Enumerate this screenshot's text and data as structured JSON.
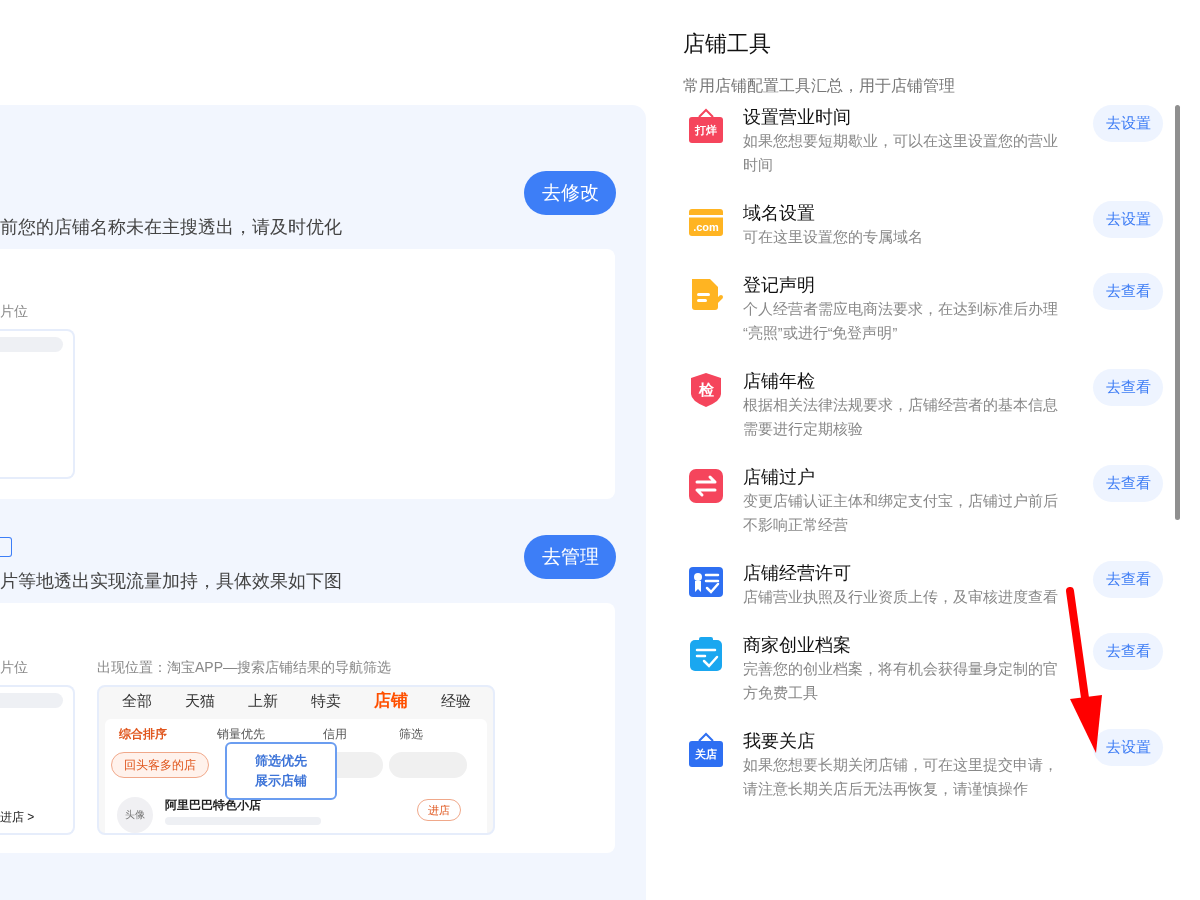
{
  "name_section": {
    "description": "前您的店铺名称未在主搜透出，请及时优化",
    "button": "去修改",
    "preview_caption": "片位"
  },
  "nav_section": {
    "description": "片等地透出实现流量加持，具体效果如下图",
    "button": "去管理",
    "left_preview": {
      "caption": "片位",
      "link": "进店 >"
    },
    "right_preview": {
      "caption": "出现位置：淘宝APP—搜索店铺结果的导航筛选",
      "tabs": [
        {
          "label": "全部",
          "selected": false
        },
        {
          "label": "天猫",
          "selected": false
        },
        {
          "label": "上新",
          "selected": false
        },
        {
          "label": "特卖",
          "selected": false
        },
        {
          "label": "店铺",
          "selected": true
        },
        {
          "label": "经验",
          "selected": false
        }
      ],
      "sorts": [
        {
          "label": "综合排序",
          "selected": true
        },
        {
          "label": "销量优先",
          "selected": false
        },
        {
          "label": "信用",
          "selected": false
        },
        {
          "label": "筛选",
          "selected": false
        }
      ],
      "chip": "回头客多的店",
      "callout_lines": [
        "筛选优先",
        "展示店铺"
      ],
      "avatar": "头像",
      "shop_name": "阿里巴巴特色小店",
      "enter_button": "进店"
    }
  },
  "tools": {
    "title": "店铺工具",
    "subtitle": "常用店铺配置工具汇总，用于店铺管理",
    "items": [
      {
        "name": "设置营业时间",
        "description": "如果您想要短期歇业，可以在这里设置您的营业时间",
        "button": "去设置",
        "kind": "sign",
        "icon_label": "打烊",
        "color": "#f5455c"
      },
      {
        "name": "域名设置",
        "description": "可在这里设置您的专属域名",
        "button": "去设置",
        "kind": "card",
        "icon_label": ".com",
        "color": "#ffb422"
      },
      {
        "name": "登记声明",
        "description": "个人经营者需应电商法要求，在达到标准后办理“亮照”或进行“免登声明”",
        "button": "去查看",
        "kind": "document",
        "color": "#ffb422"
      },
      {
        "name": "店铺年检",
        "description": "根据相关法律法规要求，店铺经营者的基本信息需要进行定期核验",
        "button": "去查看",
        "kind": "shield",
        "icon_label": "检",
        "color": "#f5455c"
      },
      {
        "name": "店铺过户",
        "description": "变更店铺认证主体和绑定支付宝，店铺过户前后不影响正常经营",
        "button": "去查看",
        "kind": "transfer",
        "color": "#f5455c"
      },
      {
        "name": "店铺经营许可",
        "description": "店铺营业执照及行业资质上传，及审核进度查看",
        "button": "去查看",
        "kind": "license",
        "color": "#2e6ff2"
      },
      {
        "name": "商家创业档案",
        "description": "完善您的创业档案，将有机会获得量身定制的官方免费工具",
        "button": "去查看",
        "kind": "clipboard",
        "color": "#1aa7f0"
      },
      {
        "name": "我要关店",
        "description": "如果您想要长期关闭店铺，可在这里提交申请，请注意长期关店后无法再恢复，请谨慎操作",
        "button": "去设置",
        "kind": "sign",
        "icon_label": "关店",
        "color": "#2e6ff2"
      }
    ]
  }
}
